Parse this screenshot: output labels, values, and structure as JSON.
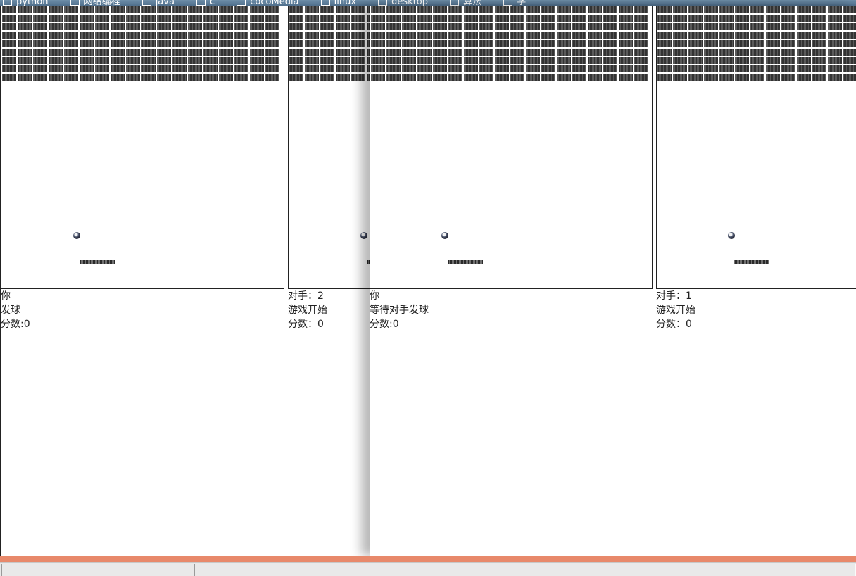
{
  "bookmarks": [
    "python",
    "网络编程",
    "java",
    "c",
    "cocoMedia",
    "linux",
    "desktop",
    "算法",
    "学"
  ],
  "windows": [
    {
      "id": "left",
      "self_panel": {
        "name": "你",
        "status": "发球",
        "score": "分数:0"
      },
      "opponent_panel": {
        "name": "对手：2",
        "status": "游戏开始",
        "score": "分数：0"
      }
    },
    {
      "id": "right",
      "self_panel": {
        "name": "你",
        "status": "等待对手发球",
        "score": "分数:0"
      },
      "opponent_panel": {
        "name": "对手：1",
        "status": "游戏开始",
        "score": "分数：0"
      }
    }
  ],
  "colors": {
    "bookmark_bar": "#5a7a96",
    "brick": "#3a3a3a",
    "accent_bar": "#e8896b",
    "statusbar": "#e9e9e9"
  }
}
